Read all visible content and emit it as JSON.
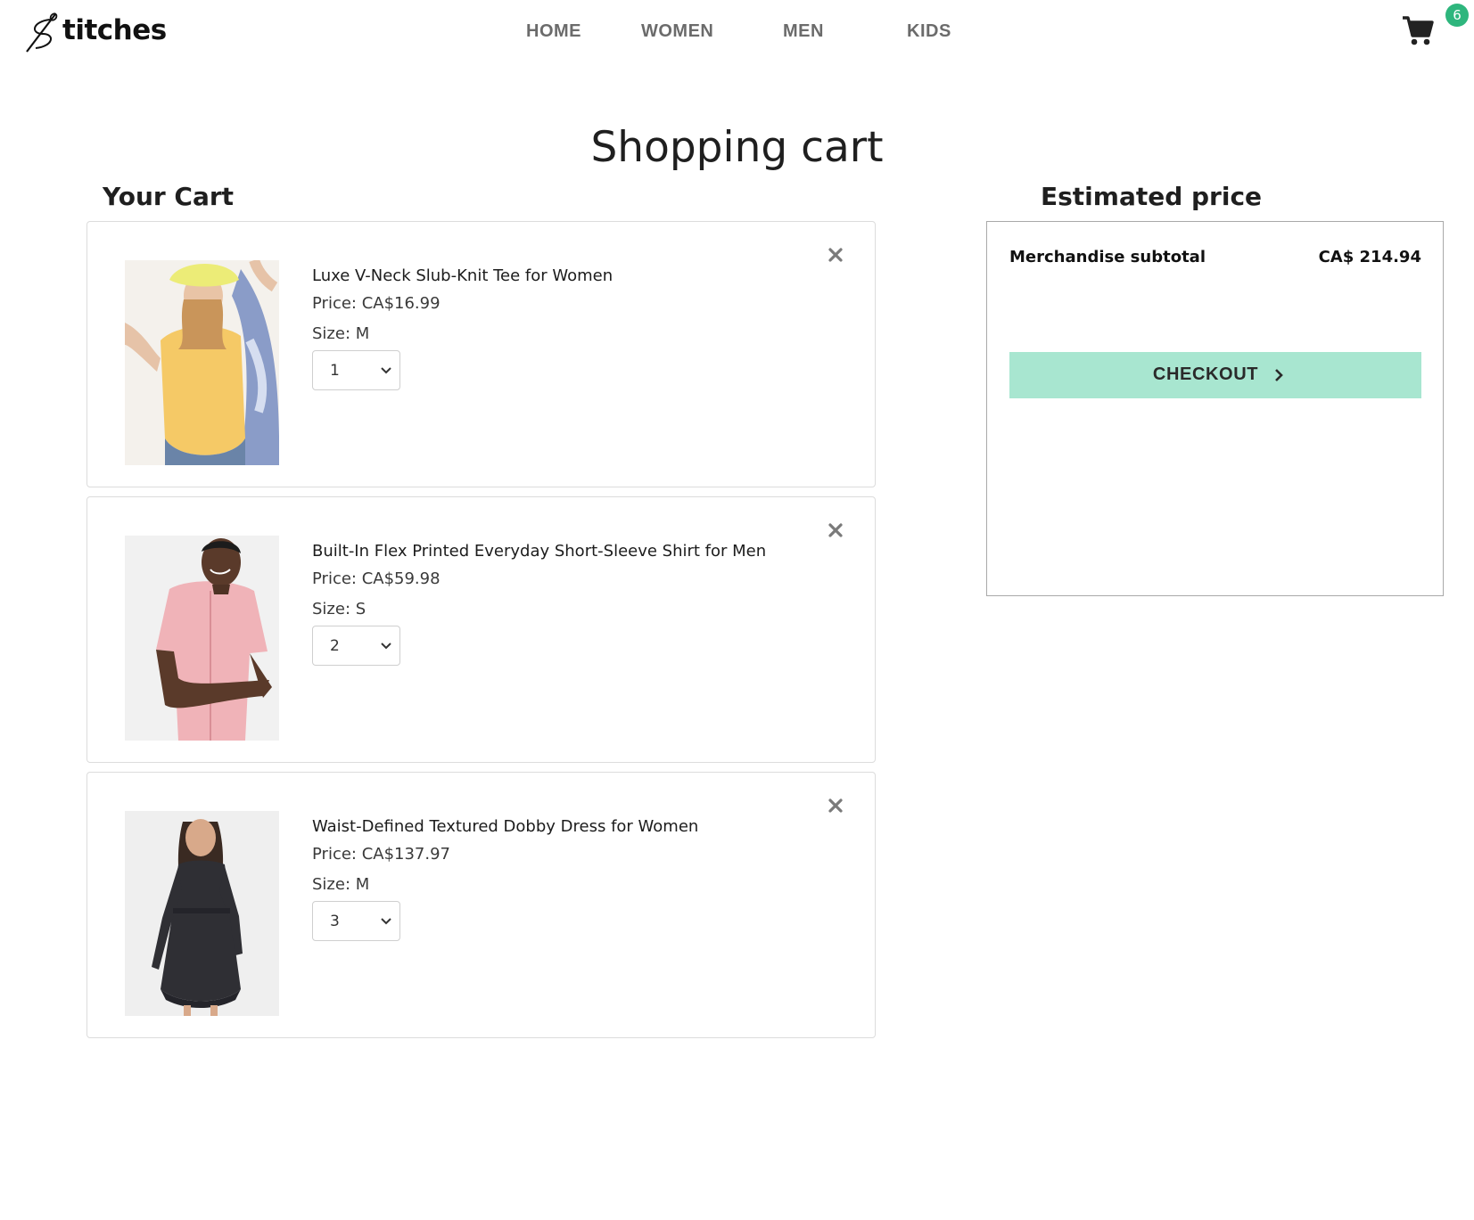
{
  "header": {
    "logo_text": "titches",
    "nav": [
      {
        "label": "HOME"
      },
      {
        "label": "WOMEN"
      },
      {
        "label": "MEN"
      },
      {
        "label": "KIDS"
      }
    ],
    "cart_count": "6",
    "icons": {
      "cart": "shopping-cart-icon",
      "logo": "needle-thread-icon"
    },
    "badge_color": "#2eb67d"
  },
  "page": {
    "title": "Shopping cart",
    "cart_heading": "Your Cart",
    "summary_heading": "Estimated price"
  },
  "cart": {
    "items": [
      {
        "name": "Luxe V-Neck Slub-Knit Tee for Women",
        "price": "Price: CA$16.99",
        "size": "Size: M",
        "quantity": "1",
        "image": "woman-yellow-tee-photo"
      },
      {
        "name": "Built-In Flex Printed Everyday Short-Sleeve Shirt for Men",
        "price": "Price: CA$59.98",
        "size": "Size: S",
        "quantity": "2",
        "image": "man-pink-shirt-photo"
      },
      {
        "name": "Waist-Defined Textured Dobby Dress for Women",
        "price": "Price: CA$137.97",
        "size": "Size: M",
        "quantity": "3",
        "image": "woman-black-dress-photo"
      }
    ]
  },
  "summary": {
    "subtotal_label": "Merchandise subtotal",
    "subtotal_value": "CA$ 214.94",
    "checkout_label": "CHECKOUT",
    "checkout_color": "#a8e6d0"
  }
}
